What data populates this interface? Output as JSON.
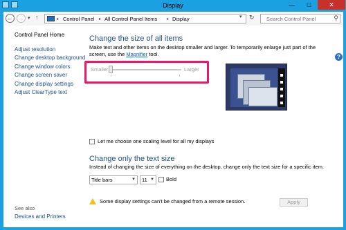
{
  "window": {
    "title": "Display",
    "minimize": "—",
    "maximize": "□",
    "close": "✕"
  },
  "nav": {
    "back": "←",
    "forward": "→",
    "down": "▾",
    "up": "↑",
    "breadcrumbs": [
      "Control Panel",
      "All Control Panel Items",
      "Display"
    ],
    "separator": "▸",
    "address_dropdown": "▾",
    "refresh": "↻",
    "search_placeholder": "Search Control Panel",
    "search_icon": "⚲"
  },
  "sidebar": {
    "home": "Control Panel Home",
    "links": [
      "Adjust resolution",
      "Change desktop background",
      "Change window colors",
      "Change screen saver",
      "Change display settings",
      "Adjust ClearType text"
    ],
    "see_also": "See also",
    "see_also_links": [
      "Devices and Printers"
    ]
  },
  "main": {
    "heading": "Change the size of all items",
    "desc_part1": "Make text and other items on the desktop smaller and larger. To temporarily enlarge just part of the screen, use the ",
    "magnifier_link": "Magnifier",
    "desc_part2": " tool.",
    "slider": {
      "min_label": "Smaller",
      "max_label": "Larger",
      "value": 0
    },
    "custom_scaling_checkbox": "Let me choose one scaling level for all my displays",
    "custom_scaling_checked": false,
    "heading2": "Change only the text size",
    "desc2": "Instead of changing the size of everything on the desktop, change only the text size for a specific item.",
    "element_select": "Title bars",
    "size_select": "11",
    "select_arrow": "▼",
    "bold_label": "Bold",
    "bold_checked": false,
    "warning": "Some display settings can't be changed from a remote session.",
    "apply_button": "Apply"
  },
  "help": "?",
  "colors": {
    "frame": "#1ba1e2",
    "close_button": "#c7312a",
    "heading": "#1e4e8c",
    "link": "#1e4e8c",
    "highlight_box": "#e8196b",
    "warning_icon": "#f2c01e"
  },
  "icons": {
    "address_bar": "monitor-icon",
    "warning": "warning-icon",
    "help": "help-icon",
    "search": "search-icon"
  }
}
